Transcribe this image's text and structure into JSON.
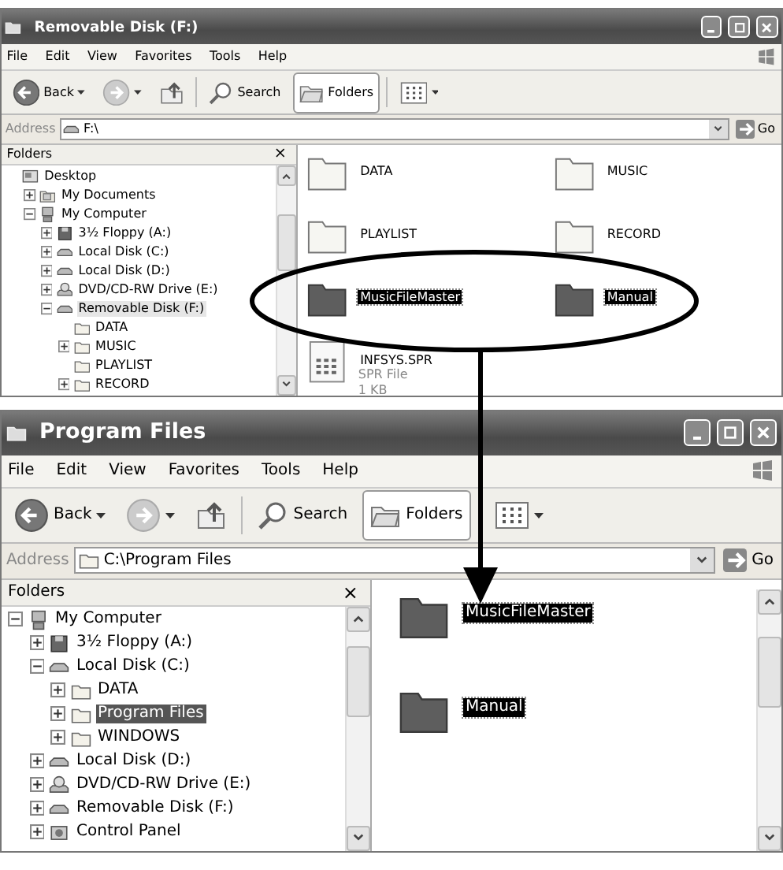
{
  "windows": [
    {
      "title": "Removable Disk (F:)",
      "menu": [
        "File",
        "Edit",
        "View",
        "Favorites",
        "Tools",
        "Help"
      ],
      "toolbar": {
        "back": "Back",
        "search": "Search",
        "folders": "Folders"
      },
      "address": {
        "label": "Address",
        "kind": "drive",
        "value": "F:\\",
        "go": "Go"
      },
      "folders_pane": {
        "title": "Folders",
        "close": "×",
        "tree_focused": false,
        "tree": [
          {
            "label": "Desktop",
            "kind": "desktop",
            "selected": false,
            "children": [
              {
                "label": "My Documents",
                "kind": "documents",
                "expanded": false,
                "selected": false
              },
              {
                "label": "My Computer",
                "kind": "computer",
                "expanded": true,
                "selected": false,
                "children": [
                  {
                    "label": "3½ Floppy (A:)",
                    "kind": "floppy",
                    "expanded": false,
                    "selected": false
                  },
                  {
                    "label": "Local Disk (C:)",
                    "kind": "drive",
                    "expanded": false,
                    "selected": false
                  },
                  {
                    "label": "Local Disk (D:)",
                    "kind": "drive",
                    "expanded": false,
                    "selected": false
                  },
                  {
                    "label": "DVD/CD-RW Drive (E:)",
                    "kind": "cdrom",
                    "expanded": false,
                    "selected": false
                  },
                  {
                    "label": "Removable Disk (F:)",
                    "kind": "drive",
                    "expanded": true,
                    "selected": true,
                    "children": [
                      {
                        "label": "DATA",
                        "kind": "folder",
                        "selected": false
                      },
                      {
                        "label": "MUSIC",
                        "kind": "folder",
                        "expanded": false,
                        "selected": false
                      },
                      {
                        "label": "PLAYLIST",
                        "kind": "folder",
                        "selected": false
                      },
                      {
                        "label": "RECORD",
                        "kind": "folder",
                        "expanded": false,
                        "selected": false
                      }
                    ]
                  }
                ]
              }
            ]
          }
        ]
      },
      "items": [
        {
          "name": "DATA",
          "kind": "folder",
          "selected": false
        },
        {
          "name": "MUSIC",
          "kind": "folder",
          "selected": false
        },
        {
          "name": "PLAYLIST",
          "kind": "folder",
          "selected": false
        },
        {
          "name": "RECORD",
          "kind": "folder",
          "selected": false
        },
        {
          "name": "MusicFileMaster",
          "kind": "folder",
          "selected": true
        },
        {
          "name": "Manual",
          "kind": "folder",
          "selected": true
        },
        {
          "name": "INFSYS.SPR",
          "kind": "file",
          "selected": false,
          "details": [
            "SPR File",
            "1 KB"
          ]
        }
      ]
    },
    {
      "title": "Program Files",
      "menu": [
        "File",
        "Edit",
        "View",
        "Favorites",
        "Tools",
        "Help"
      ],
      "toolbar": {
        "back": "Back",
        "search": "Search",
        "folders": "Folders"
      },
      "address": {
        "label": "Address",
        "kind": "folder",
        "value": "C:\\Program Files",
        "go": "Go"
      },
      "folders_pane": {
        "title": "Folders",
        "close": "×",
        "tree_focused": true,
        "tree": [
          {
            "label": "My Computer",
            "kind": "computer",
            "expanded": true,
            "selected": false,
            "children": [
              {
                "label": "3½ Floppy (A:)",
                "kind": "floppy",
                "expanded": false,
                "selected": false
              },
              {
                "label": "Local Disk (C:)",
                "kind": "drive",
                "expanded": true,
                "selected": false,
                "children": [
                  {
                    "label": "DATA",
                    "kind": "folder",
                    "expanded": false,
                    "selected": false
                  },
                  {
                    "label": "Program Files",
                    "kind": "folder",
                    "expanded": false,
                    "selected": true
                  },
                  {
                    "label": "WINDOWS",
                    "kind": "folder",
                    "expanded": false,
                    "selected": false
                  }
                ]
              },
              {
                "label": "Local Disk (D:)",
                "kind": "drive",
                "expanded": false,
                "selected": false
              },
              {
                "label": "DVD/CD-RW Drive (E:)",
                "kind": "cdrom",
                "expanded": false,
                "selected": false
              },
              {
                "label": "Removable Disk (F:)",
                "kind": "drive",
                "expanded": false,
                "selected": false
              },
              {
                "label": "Control Panel",
                "kind": "control_panel",
                "expanded": false,
                "selected": false
              }
            ]
          }
        ]
      },
      "items": [
        {
          "name": "MusicFileMaster",
          "kind": "folder",
          "selected": true
        },
        {
          "name": "Manual",
          "kind": "folder",
          "selected": true
        }
      ]
    }
  ]
}
